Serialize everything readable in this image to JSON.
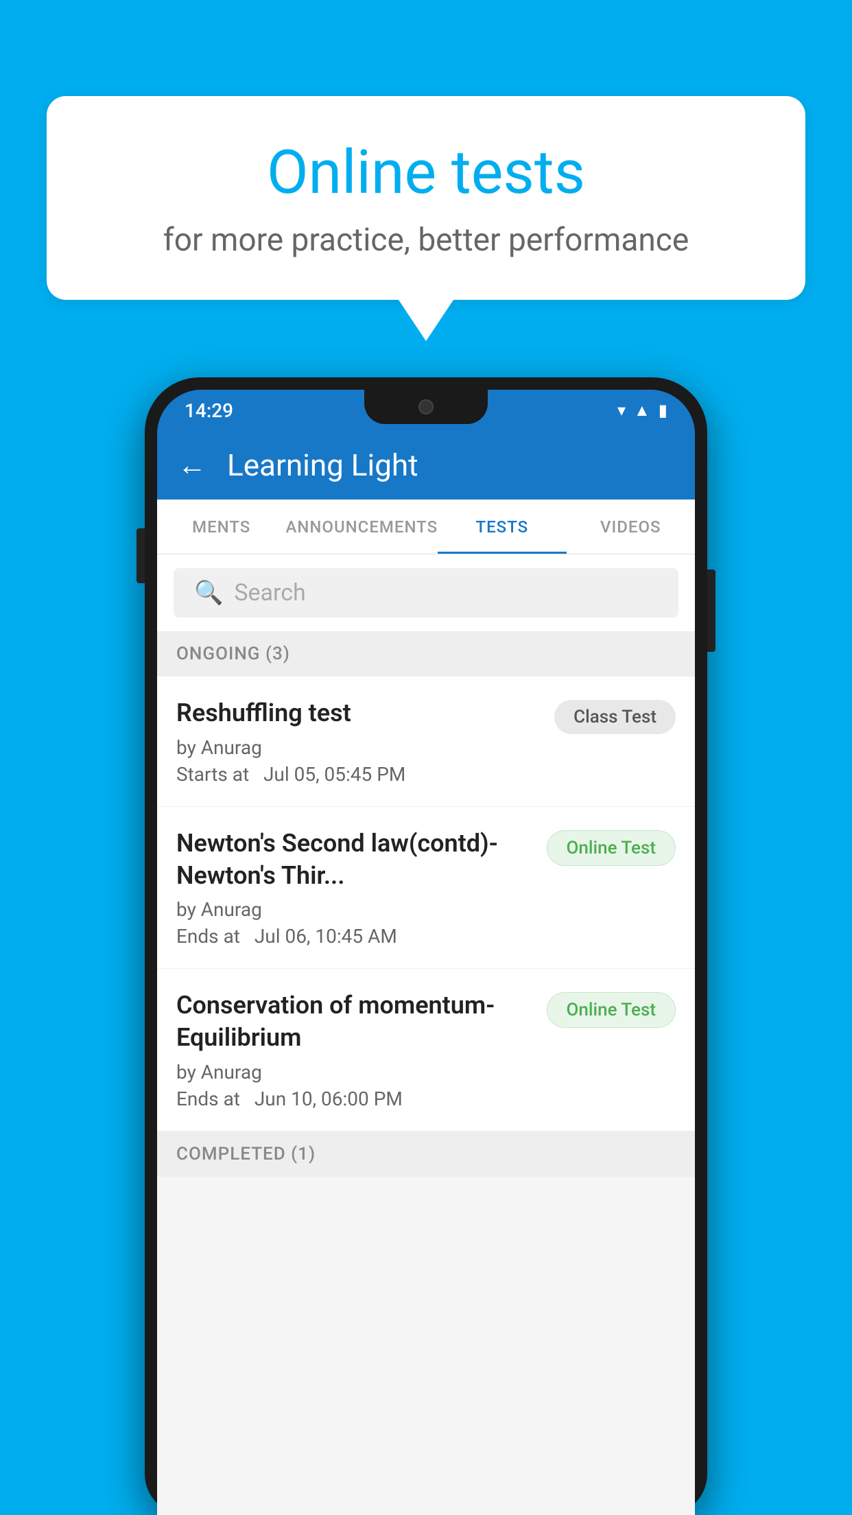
{
  "background_color": "#00AEEF",
  "speech_bubble": {
    "title": "Online tests",
    "subtitle": "for more practice, better performance"
  },
  "phone": {
    "status_bar": {
      "time": "14:29",
      "icons": [
        "wifi",
        "signal",
        "battery"
      ]
    },
    "app_bar": {
      "title": "Learning Light",
      "back_label": "←"
    },
    "tabs": [
      {
        "label": "MENTS",
        "active": false
      },
      {
        "label": "ANNOUNCEMENTS",
        "active": false
      },
      {
        "label": "TESTS",
        "active": true
      },
      {
        "label": "VIDEOS",
        "active": false
      }
    ],
    "search": {
      "placeholder": "Search"
    },
    "ongoing_section": {
      "header": "ONGOING (3)",
      "items": [
        {
          "name": "Reshuffling test",
          "author": "by Anurag",
          "time_label": "Starts at",
          "time": "Jul 05, 05:45 PM",
          "badge": "Class Test",
          "badge_type": "class"
        },
        {
          "name": "Newton's Second law(contd)-Newton's Thir...",
          "author": "by Anurag",
          "time_label": "Ends at",
          "time": "Jul 06, 10:45 AM",
          "badge": "Online Test",
          "badge_type": "online"
        },
        {
          "name": "Conservation of momentum-Equilibrium",
          "author": "by Anurag",
          "time_label": "Ends at",
          "time": "Jun 10, 06:00 PM",
          "badge": "Online Test",
          "badge_type": "online"
        }
      ]
    },
    "completed_section": {
      "header": "COMPLETED (1)"
    }
  }
}
